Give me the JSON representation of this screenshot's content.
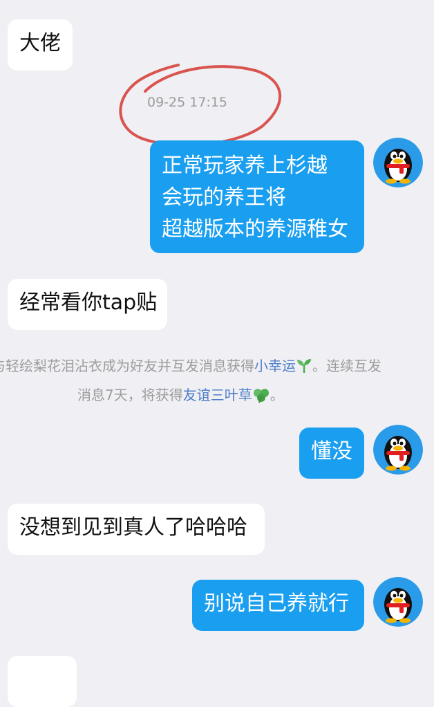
{
  "messages": {
    "m1": "大佬",
    "m2_lines": [
      "正常玩家养上杉越",
      "会玩的养王将",
      "超越版本的养源稚女"
    ],
    "m3": "经常看你tap贴",
    "m4": "懂没",
    "m5": "没想到见到真人了哈哈哈",
    "m6": "别说自己养就行"
  },
  "timestamp": "09-25 17:15",
  "system_notice": {
    "line1_prefix": "与轻绘梨花泪沾衣成为好友并互发消息获得",
    "link1": "小幸运",
    "line1_suffix": "。连续互发",
    "line2_prefix": "消息7天，将获得",
    "link2": "友谊三叶草",
    "line2_suffix": "。"
  },
  "icons": {
    "avatar": "qq-penguin-avatar",
    "sprout": "sprout-icon",
    "clover": "clover-icon"
  },
  "colors": {
    "background": "#efeff4",
    "sent_bubble": "#1a9ff0",
    "received_bubble": "#ffffff",
    "link": "#4e7ec8",
    "annotation_circle": "#d9534f"
  }
}
